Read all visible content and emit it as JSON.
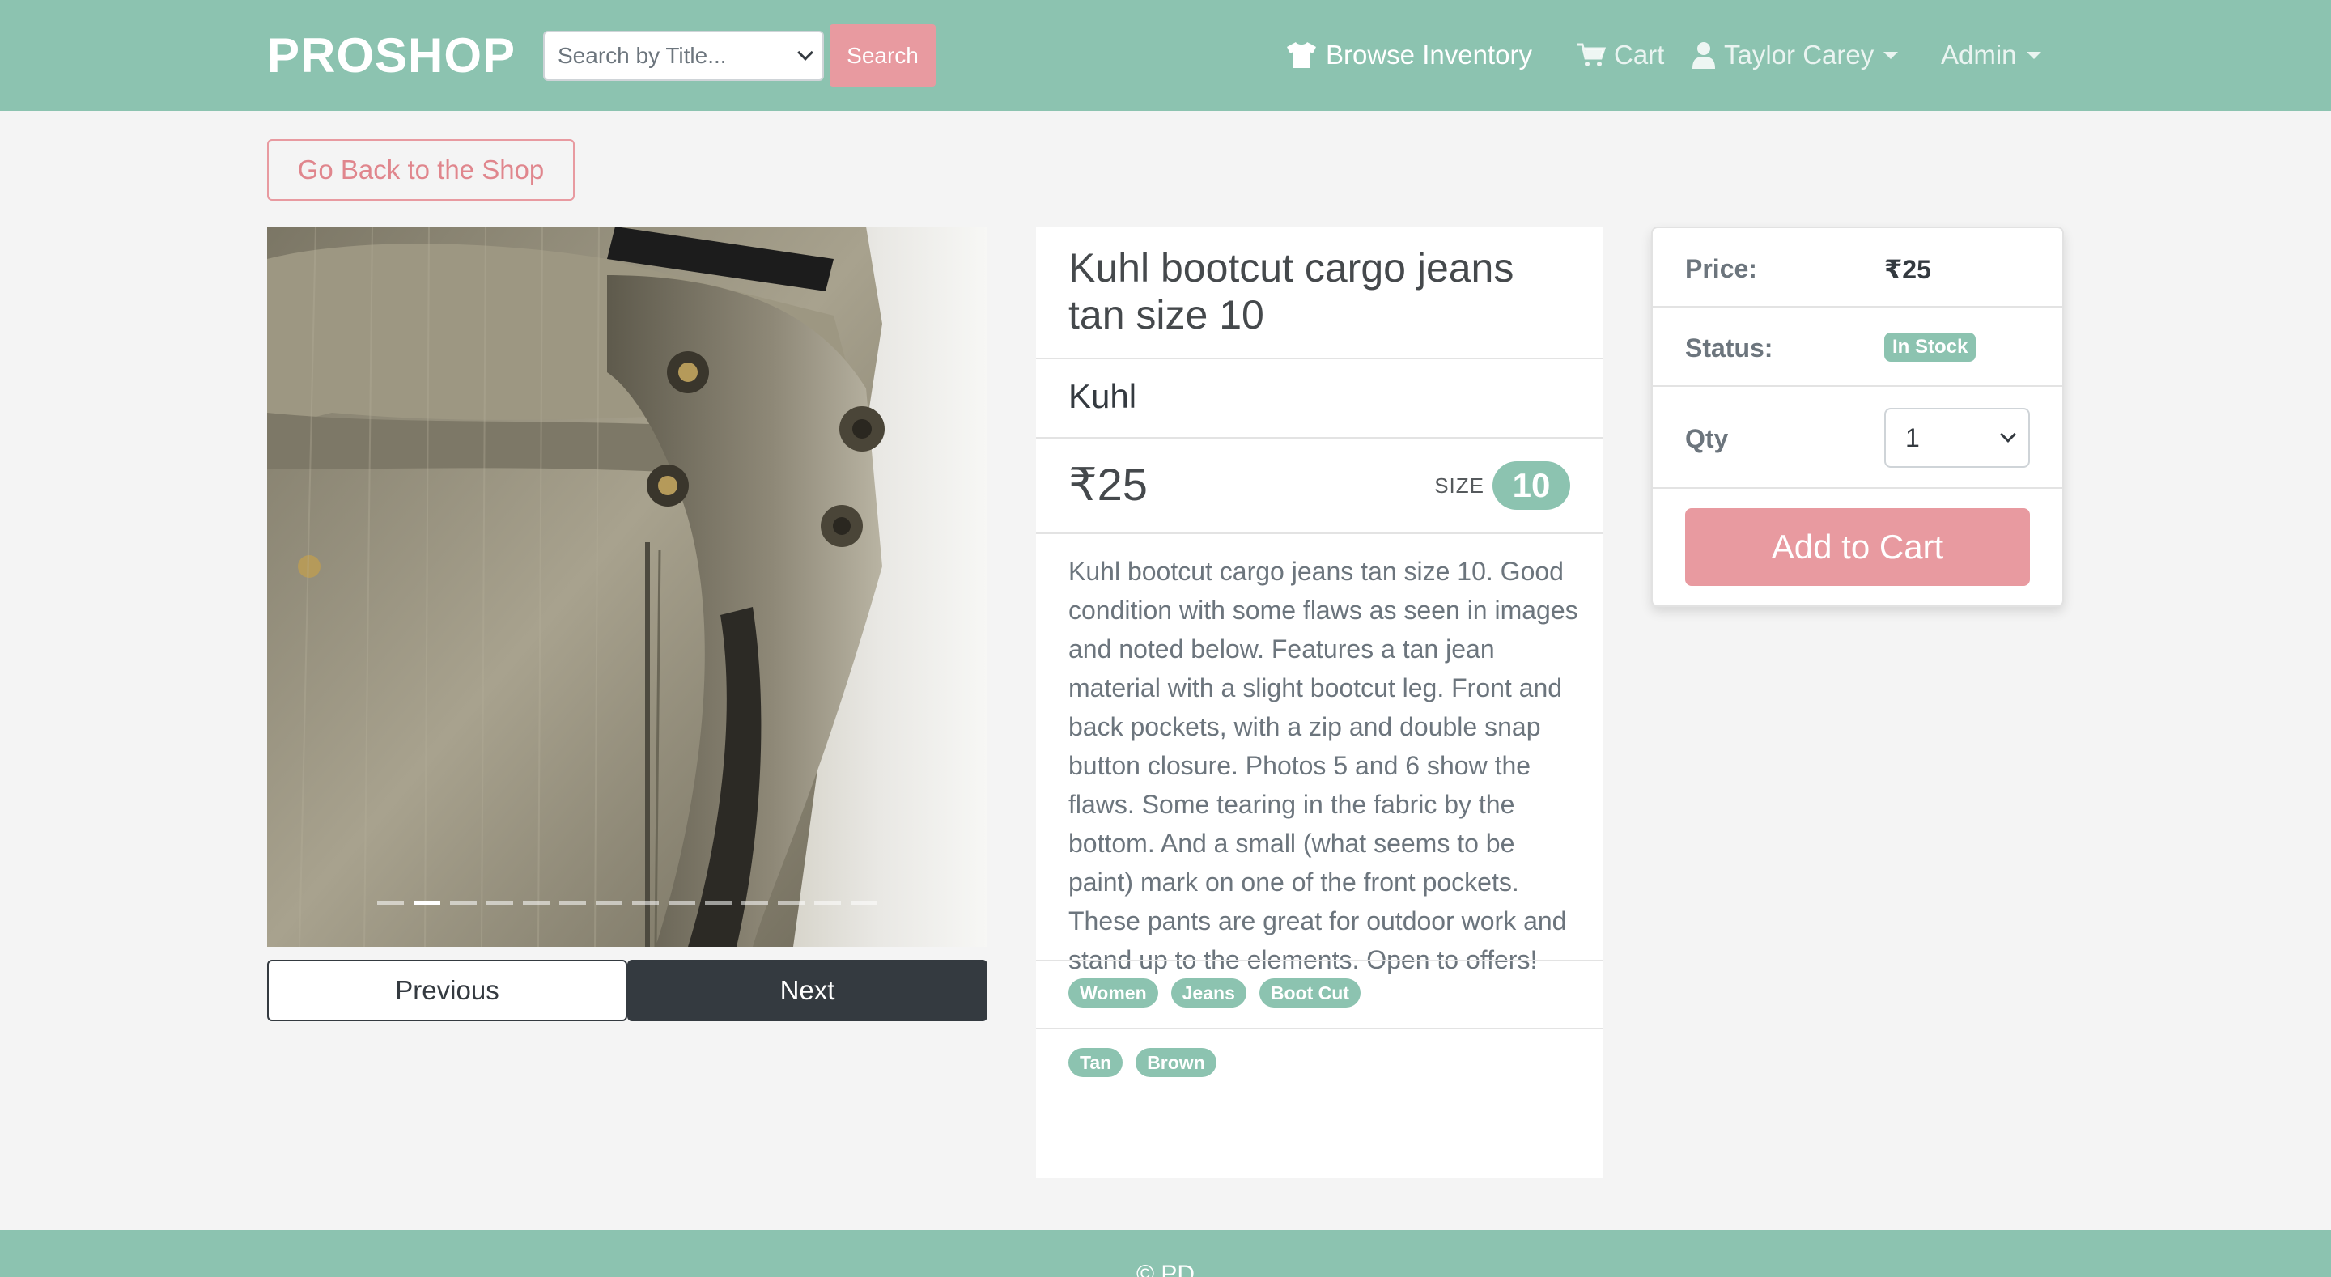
{
  "navbar": {
    "brand": "PROSHOP",
    "search_placeholder": "Search by Title...",
    "search_button": "Search",
    "browse": "Browse Inventory",
    "cart": "Cart",
    "user": "Taylor Carey",
    "admin": "Admin"
  },
  "back_button": "Go Back to the Shop",
  "carousel": {
    "slide_count": 14,
    "active_index": 1,
    "previous": "Previous",
    "next": "Next"
  },
  "product": {
    "title": "Kuhl bootcut cargo jeans tan size 10",
    "brand": "Kuhl",
    "price": "₹25",
    "size_label": "SIZE",
    "size": "10",
    "description": "Kuhl bootcut cargo jeans tan size 10. Good condition with some flaws as seen in images and noted below. Features a tan jean material with a slight bootcut leg. Front and back pockets, with a zip and double snap button closure. Photos 5 and 6 show the flaws. Some tearing in the fabric by the bottom. And a small (what seems to be paint) mark on one of the front pockets. These pants are great for outdoor work and stand up to the elements. Open to offers!",
    "category_tags": [
      "Women",
      "Jeans",
      "Boot Cut"
    ],
    "color_tags": [
      "Tan",
      "Brown"
    ]
  },
  "buy_box": {
    "price_label": "Price:",
    "price_value": "₹25",
    "status_label": "Status:",
    "status_value": "In Stock",
    "qty_label": "Qty",
    "qty_value": "1",
    "add_button": "Add to Cart"
  },
  "footer": {
    "text": "© PD"
  },
  "colors": {
    "primary": "#8cc3b0",
    "accent": "#e89aa0",
    "dark": "#343a40",
    "background": "#f4f4f4"
  }
}
